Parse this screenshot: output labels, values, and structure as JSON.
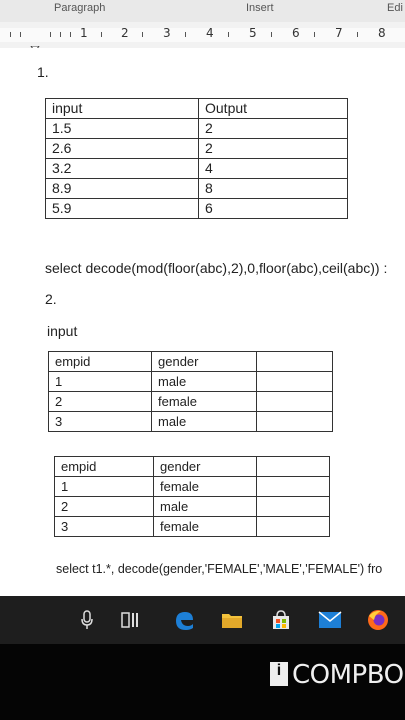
{
  "ribbon": {
    "paragraph": "Paragraph",
    "insert": "Insert",
    "edit": "Edi"
  },
  "ruler": {
    "numbers": [
      "1",
      "2",
      "3",
      "4",
      "5",
      "6",
      "7",
      "8"
    ]
  },
  "q1": {
    "number": "1.",
    "headers": [
      "input",
      "Output"
    ],
    "rows": [
      [
        "1.5",
        "2"
      ],
      [
        "2.6",
        "2"
      ],
      [
        "3.2",
        "4"
      ],
      [
        "8.9",
        "8"
      ],
      [
        "5.9",
        "6"
      ]
    ],
    "query": "select decode(mod(floor(abc),2),0,floor(abc),ceil(abc)) :"
  },
  "q2": {
    "number": "2.",
    "input_label": "input",
    "table1": {
      "headers": [
        "empid",
        "gender",
        ""
      ],
      "rows": [
        [
          "1",
          "male",
          ""
        ],
        [
          "2",
          "female",
          ""
        ],
        [
          "3",
          "male",
          ""
        ]
      ]
    },
    "table2": {
      "headers": [
        "empid",
        "gender",
        ""
      ],
      "rows": [
        [
          "1",
          "female",
          ""
        ],
        [
          "2",
          "male",
          ""
        ],
        [
          "3",
          "female",
          ""
        ]
      ]
    },
    "query": "select t1.*, decode(gender,'FEMALE','MALE','FEMALE') fro"
  },
  "taskbar": {
    "icons": [
      "microphone-icon",
      "task-view-icon",
      "edge-icon",
      "file-explorer-icon",
      "store-icon",
      "mail-icon",
      "firefox-icon"
    ]
  },
  "watermark": {
    "brand": "COMPBOO",
    "mark": "i"
  },
  "colors": {
    "page_bg": "#ffffff",
    "taskbar_bg": "#1e1e1e",
    "edge_blue": "#1d7fd6",
    "folder_yellow": "#f3c23c",
    "firefox_orange": "#ff6a1a"
  }
}
